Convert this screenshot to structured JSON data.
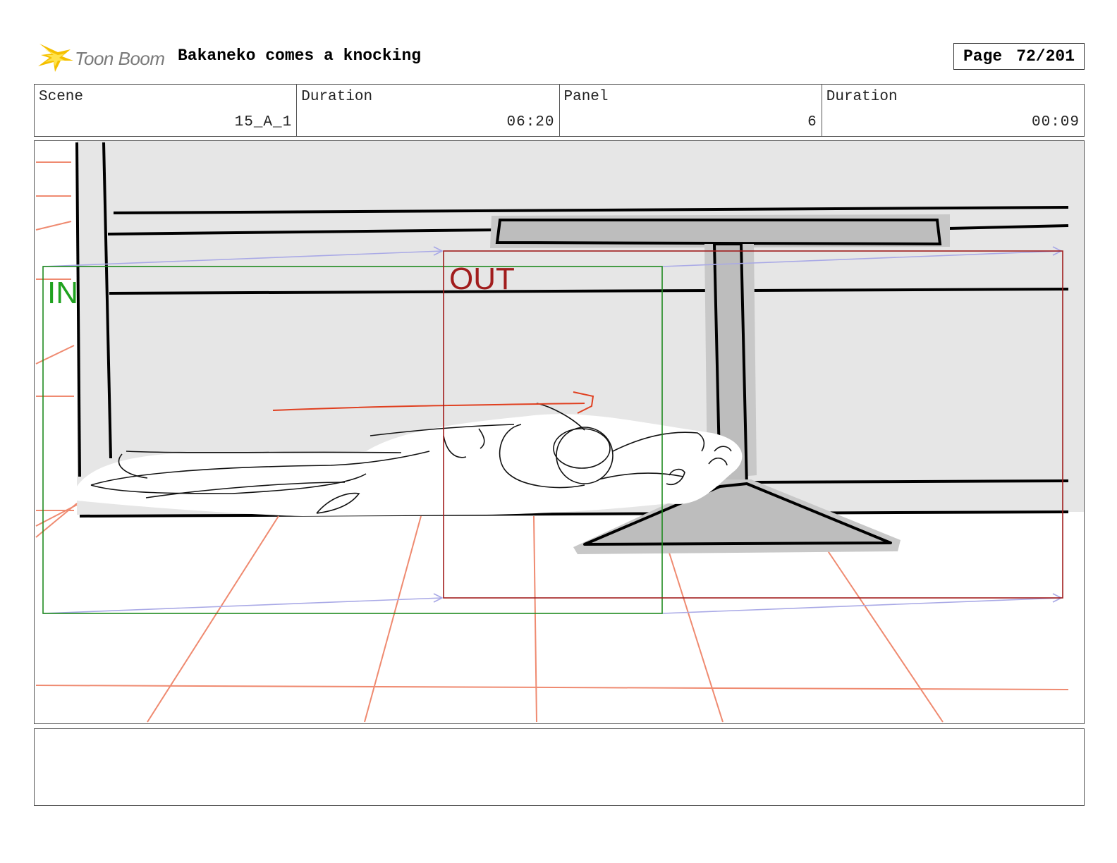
{
  "header": {
    "logo_text": "Toon Boom",
    "title": "Bakaneko comes a knocking",
    "page_label": "Page",
    "page_value": "72/201"
  },
  "info": {
    "scene_label": "Scene",
    "scene_value": "15_A_1",
    "scene_duration_label": "Duration",
    "scene_duration_value": "06:20",
    "panel_label": "Panel",
    "panel_value": "6",
    "panel_duration_label": "Duration",
    "panel_duration_value": "00:09"
  },
  "panel": {
    "in_label": "IN",
    "out_label": "OUT"
  },
  "colors": {
    "in_frame": "#1f8a1f",
    "out_frame": "#a11d1d",
    "floor_lines": "#ef8a70",
    "motion_path": "#a9a9e6",
    "logo_burst": "#f5c000"
  },
  "notes": ""
}
